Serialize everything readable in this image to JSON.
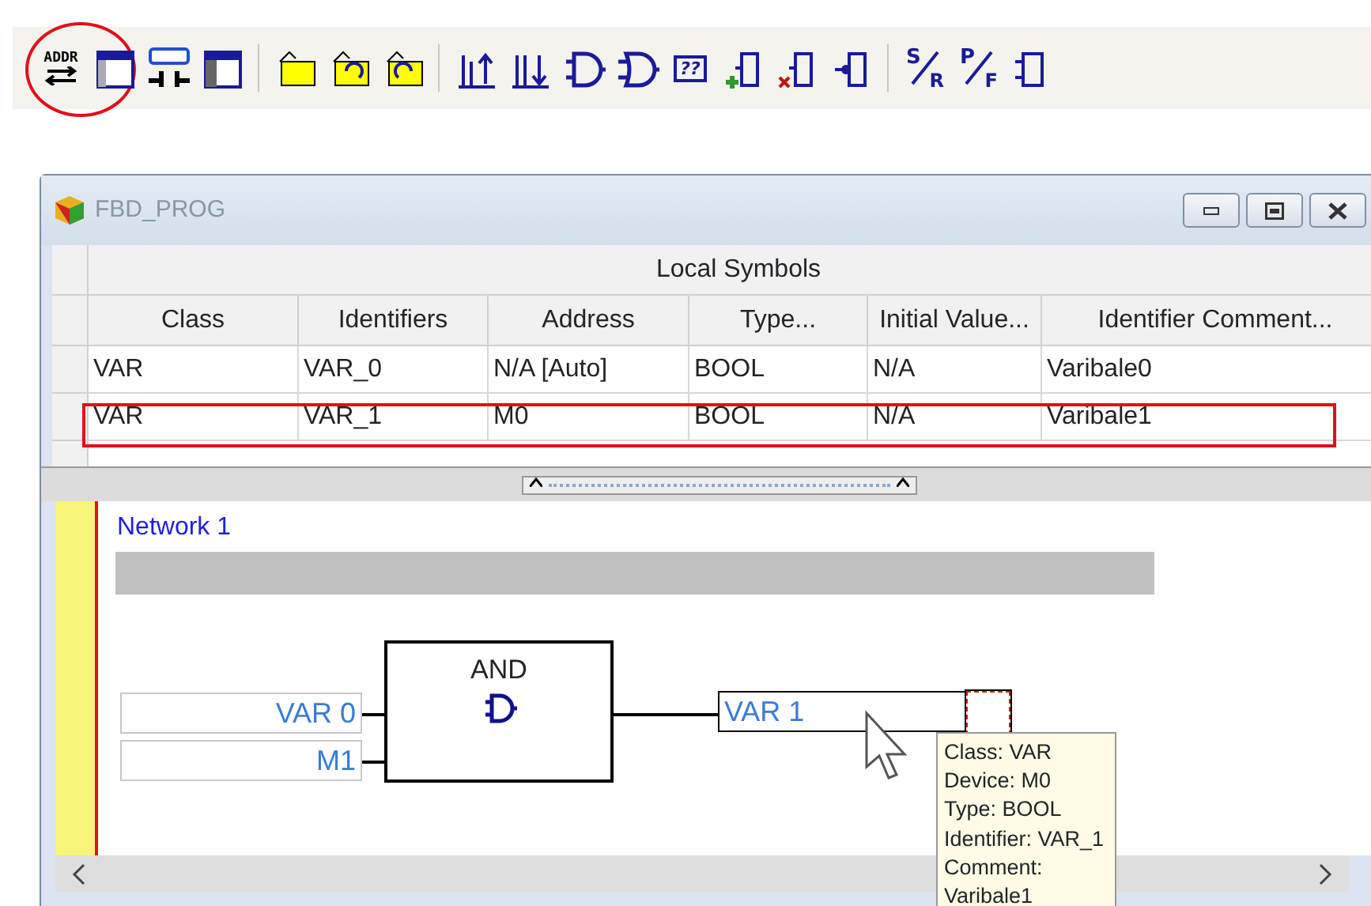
{
  "toolbar": [
    {
      "kind": "addr",
      "text": "ADDR",
      "circled": true
    },
    {
      "kind": "window"
    },
    {
      "kind": "netcomment"
    },
    {
      "kind": "window2"
    },
    {
      "kind": "sep"
    },
    {
      "kind": "note"
    },
    {
      "kind": "note-undo"
    },
    {
      "kind": "note-redo"
    },
    {
      "kind": "sep"
    },
    {
      "kind": "rung-up"
    },
    {
      "kind": "rung-down"
    },
    {
      "kind": "and"
    },
    {
      "kind": "or"
    },
    {
      "kind": "func",
      "text": "??"
    },
    {
      "kind": "insert"
    },
    {
      "kind": "delete"
    },
    {
      "kind": "output"
    },
    {
      "kind": "sep"
    },
    {
      "kind": "letters",
      "text": "S",
      "sub": "R"
    },
    {
      "kind": "letters",
      "text": "P",
      "sub": "F"
    },
    {
      "kind": "block"
    }
  ],
  "window": {
    "title": "FBD_PROG",
    "table": {
      "title": "Local Symbols",
      "columns": [
        "Class",
        "Identifiers",
        "Address",
        "Type...",
        "Initial Value...",
        "Identifier Comment..."
      ],
      "rows": [
        {
          "cells": [
            "VAR",
            "VAR_0",
            "N/A [Auto]",
            "BOOL",
            "N/A",
            "Varibale0"
          ],
          "circled": false
        },
        {
          "cells": [
            "VAR",
            "VAR_1",
            "M0",
            "BOOL",
            "N/A",
            "Varibale1"
          ],
          "circled": true
        }
      ]
    },
    "network": {
      "title": "Network 1",
      "block": {
        "name": "AND"
      },
      "inputs": [
        "VAR 0",
        "M1"
      ],
      "output": "VAR 1",
      "tooltip": [
        "Class: VAR",
        "Device: M0",
        "Type: BOOL",
        "Identifier: VAR_1",
        "Comment:",
        "Varibale1"
      ]
    }
  }
}
